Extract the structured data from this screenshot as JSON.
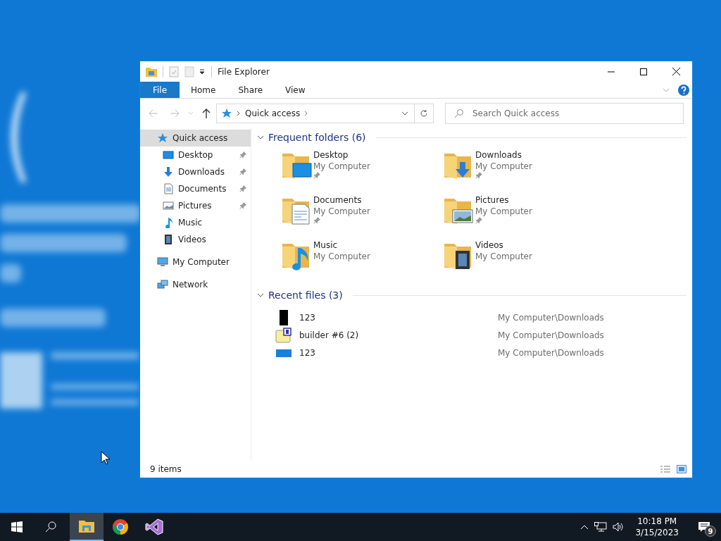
{
  "window": {
    "title": "File Explorer"
  },
  "ribbon_tabs": [
    {
      "label": "File",
      "selected": true
    },
    {
      "label": "Home",
      "selected": false
    },
    {
      "label": "Share",
      "selected": false
    },
    {
      "label": "View",
      "selected": false
    }
  ],
  "address": {
    "path": "Quick access"
  },
  "search": {
    "placeholder": "Search Quick access"
  },
  "sidebar": {
    "items": [
      {
        "label": "Quick access",
        "kind": "star",
        "selected": true,
        "children": [
          {
            "label": "Desktop",
            "kind": "desktop",
            "pinned": true,
            "selected": false
          },
          {
            "label": "Downloads",
            "kind": "downloads",
            "pinned": true,
            "selected": false
          },
          {
            "label": "Documents",
            "kind": "documents",
            "pinned": true,
            "selected": false
          },
          {
            "label": "Pictures",
            "kind": "pictures",
            "pinned": true,
            "selected": false
          },
          {
            "label": "Music",
            "kind": "music",
            "pinned": false,
            "selected": false
          },
          {
            "label": "Videos",
            "kind": "videos",
            "pinned": false,
            "selected": false
          }
        ]
      },
      {
        "label": "My Computer",
        "kind": "computer",
        "selected": false
      },
      {
        "label": "Network",
        "kind": "network",
        "selected": false
      }
    ]
  },
  "frequent_folders": {
    "title": "Frequent folders (6)",
    "expanded": true,
    "items": [
      {
        "name": "Desktop",
        "location": "My Computer",
        "kind": "desktop",
        "pinned": true
      },
      {
        "name": "Downloads",
        "location": "My Computer",
        "kind": "downloads",
        "pinned": true
      },
      {
        "name": "Documents",
        "location": "My Computer",
        "kind": "documents",
        "pinned": true
      },
      {
        "name": "Pictures",
        "location": "My Computer",
        "kind": "pictures",
        "pinned": true
      },
      {
        "name": "Music",
        "location": "My Computer",
        "kind": "music",
        "pinned": false
      },
      {
        "name": "Videos",
        "location": "My Computer",
        "kind": "videos",
        "pinned": false
      }
    ]
  },
  "recent_files": {
    "title": "Recent files (3)",
    "expanded": true,
    "items": [
      {
        "name": "123",
        "path": "My Computer\\Downloads",
        "kind": "black"
      },
      {
        "name": "builder #6 (2)",
        "path": "My Computer\\Downloads",
        "kind": "registry"
      },
      {
        "name": "123",
        "path": "My Computer\\Downloads",
        "kind": "blue"
      }
    ]
  },
  "status_bar": {
    "count": "9 items"
  },
  "taskbar": {
    "apps": [
      {
        "kind": "explorer",
        "selected": true
      },
      {
        "kind": "chrome",
        "selected": false
      },
      {
        "kind": "visualstudio",
        "selected": false
      }
    ],
    "time": "10:18 PM",
    "date": "3/15/2023",
    "notifications": "9"
  }
}
